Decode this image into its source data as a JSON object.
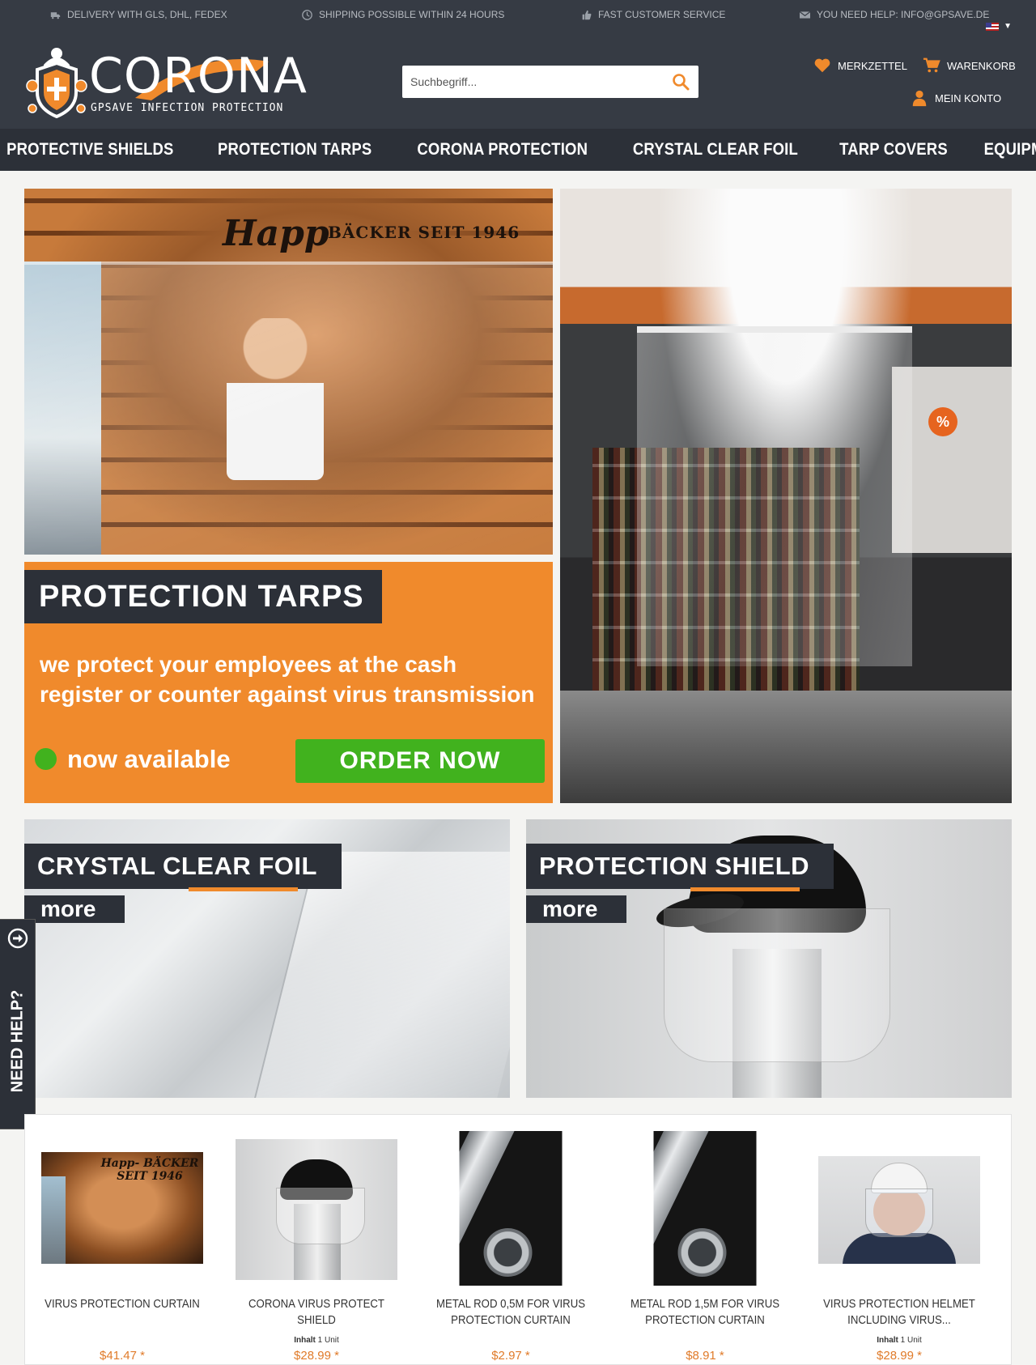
{
  "topbar": {
    "usps": [
      {
        "icon": "truck-icon",
        "text": "DELIVERY WITH GLS, DHL, FEDEX"
      },
      {
        "icon": "clock-icon",
        "text": "SHIPPING POSSIBLE WITHIN 24 HOURS"
      },
      {
        "icon": "thumbs-up-icon",
        "text": "FAST CUSTOMER SERVICE"
      },
      {
        "icon": "envelope-icon",
        "text": "YOU NEED HELP: INFO@GPSAVE.DE"
      }
    ],
    "language_flag": "us-flag-icon"
  },
  "header": {
    "logo_word": "CORONA",
    "logo_sub": "GPSAVE INFECTION PROTECTION",
    "search": {
      "placeholder": "Suchbegriff..."
    },
    "merkzettel": "MERKZETTEL",
    "warenkorb": "WARENKORB",
    "account": "MEIN KONTO"
  },
  "nav": {
    "items": [
      "PROTECTIVE SHIELDS",
      "PROTECTION TARPS",
      "CORONA PROTECTION",
      "CRYSTAL CLEAR FOIL",
      "TARP COVERS",
      "EQUIPMENT"
    ]
  },
  "hero": {
    "bakery_sign": "Happ",
    "bakery_sign_2": "BÄCKER SEIT 1946",
    "title": "PROTECTION TARPS",
    "text": "we protect your employees at the cash register or counter against virus transmission",
    "available": "now available",
    "order": "ORDER NOW",
    "percent_sign": "%"
  },
  "teasers": [
    {
      "title": "CRYSTAL CLEAR FOIL",
      "more": "more"
    },
    {
      "title": "PROTECTION SHIELD",
      "more": "more"
    }
  ],
  "need_help": "NEED HELP?",
  "products": [
    {
      "name": "VIRUS PROTECTION CURTAIN",
      "inhalt_label": "",
      "inhalt_value": "",
      "price": "$41.47 *",
      "image_sign": "Happ- BÄCKER SEIT 1946"
    },
    {
      "name": "CORONA VIRUS PROTECT SHIELD",
      "inhalt_label": "Inhalt",
      "inhalt_value": "1 Unit",
      "price": "$28.99 *"
    },
    {
      "name": "METAL ROD 0,5M FOR VIRUS PROTECTION CURTAIN",
      "inhalt_label": "",
      "inhalt_value": "",
      "price": "$2.97 *"
    },
    {
      "name": "METAL ROD 1,5M FOR VIRUS PROTECTION CURTAIN",
      "inhalt_label": "",
      "inhalt_value": "",
      "price": "$8.91 *"
    },
    {
      "name": "VIRUS PROTECTION HELMET INCLUDING VIRUS...",
      "inhalt_label": "Inhalt",
      "inhalt_value": "1 Unit",
      "price": "$28.99 *"
    }
  ],
  "colors": {
    "accent": "#f08a2c",
    "dark": "#2c3038",
    "header": "#363b44",
    "green": "#41b21e"
  }
}
